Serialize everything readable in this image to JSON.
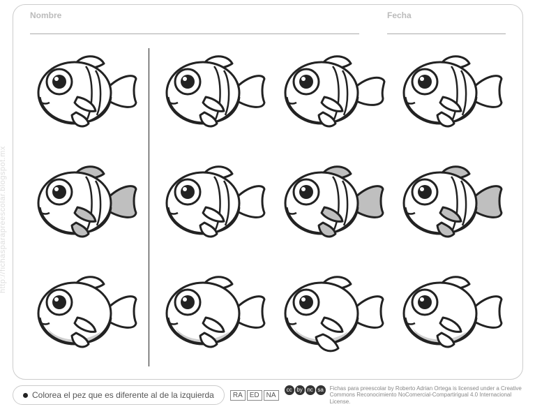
{
  "header": {
    "name_label": "Nombre",
    "date_label": "Fecha"
  },
  "watermark": "http://fichasparapreescolar.blogspot.mx",
  "instruction": "Colorea el pez que es diferente al de la izquierda",
  "badges": [
    "RA",
    "ED",
    "NA"
  ],
  "cc_icons": [
    "cc",
    "by",
    "nc",
    "sa"
  ],
  "license_text": "Fichas para preescolar by Roberto Adrian Ortega is licensed under a Creative Commons Reconocimiento NoComercial-Compartirigual 4.0 Internacional License.",
  "fish_rows": [
    {
      "reference": {
        "fins": "white",
        "stripes": true,
        "belly": "white"
      },
      "options": [
        {
          "fins": "white",
          "stripes": true,
          "belly": "white"
        },
        {
          "fins": "white",
          "stripes": true,
          "belly": "white",
          "tail_variant": true
        },
        {
          "fins": "white",
          "stripes": true,
          "belly": "white"
        }
      ]
    },
    {
      "reference": {
        "fins": "gray",
        "stripes": true,
        "belly": "white"
      },
      "options": [
        {
          "fins": "white",
          "stripes": true,
          "belly": "white"
        },
        {
          "fins": "gray",
          "stripes": true,
          "belly": "white"
        },
        {
          "fins": "gray",
          "stripes": true,
          "belly": "white"
        }
      ]
    },
    {
      "reference": {
        "fins": "white",
        "stripes": false,
        "belly": "gray"
      },
      "options": [
        {
          "fins": "white",
          "stripes": false,
          "belly": "gray"
        },
        {
          "fins": "white",
          "stripes": false,
          "belly": "gray",
          "bottom_fin_variant": true
        },
        {
          "fins": "white",
          "stripes": false,
          "belly": "gray"
        }
      ]
    }
  ]
}
